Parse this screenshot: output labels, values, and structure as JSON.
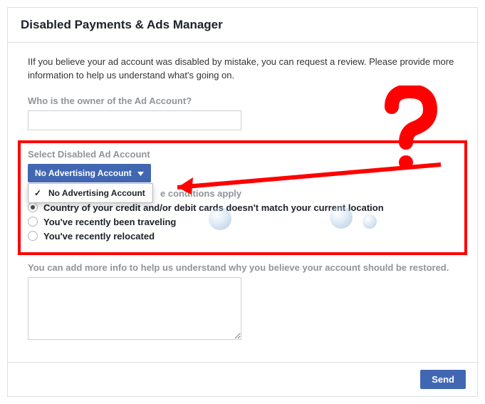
{
  "header": {
    "title": "Disabled Payments & Ads Manager"
  },
  "intro": "IIf you believe your ad account was disabled by mistake, you can request a review. Please provide more information to help us understand what's going on.",
  "owner": {
    "label": "Who is the owner of the Ad Account?",
    "value": ""
  },
  "disabledAccount": {
    "label": "Select Disabled Ad Account",
    "button": "No Advertising Account",
    "options": [
      {
        "label": "No Advertising Account",
        "checked": true
      }
    ]
  },
  "conditions": {
    "label": "e conditions apply",
    "items": [
      {
        "label": "Country of your credit and/or debit cards doesn't match your current location",
        "selected": true
      },
      {
        "label": "You've recently been traveling",
        "selected": false
      },
      {
        "label": "You've recently relocated",
        "selected": false
      }
    ]
  },
  "moreInfo": {
    "label": "You can add more info to help us understand why you believe your account should be restored.",
    "value": ""
  },
  "footer": {
    "send": "Send"
  }
}
